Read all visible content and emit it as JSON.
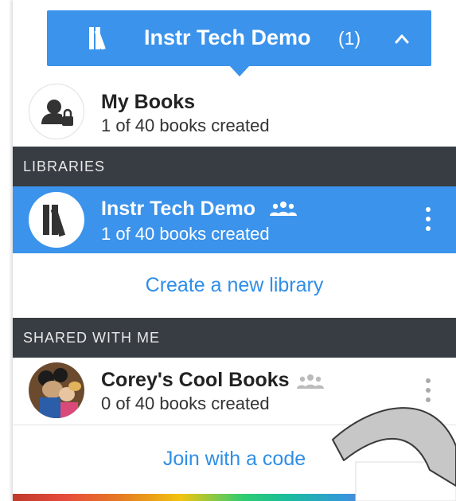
{
  "header": {
    "library_title": "Instr Tech Demo",
    "library_count": "(1)"
  },
  "my_books": {
    "name": "My Books",
    "subtitle": "1 of 40 books created"
  },
  "libraries": {
    "section_label": "LIBRARIES",
    "items": [
      {
        "name": "Instr Tech Demo",
        "subtitle": "1 of 40 books created",
        "icon": "group-icon"
      }
    ],
    "create_label": "Create a new library"
  },
  "shared": {
    "section_label": "SHARED WITH ME",
    "items": [
      {
        "name": "Corey's Cool Books",
        "subtitle": "0 of 40 books created",
        "icon": "group-icon"
      }
    ],
    "join_label": "Join with a code"
  },
  "colors": {
    "accent": "#3b93ec",
    "section_bg": "#383c43",
    "link": "#2f8ee6"
  }
}
